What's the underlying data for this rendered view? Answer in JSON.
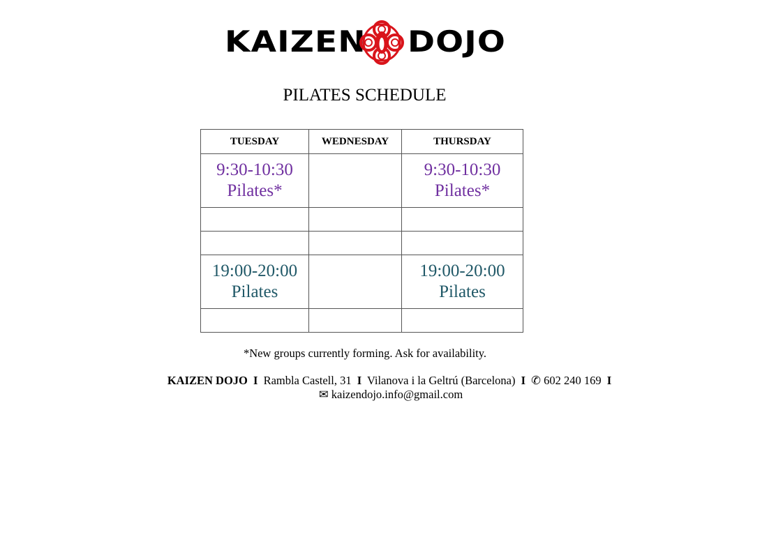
{
  "logo": {
    "left_text": "KAIZEN",
    "right_text": "DOJO",
    "emblem": "red-knot-crest-icon",
    "colors": {
      "text": "#000000",
      "emblem": "#d9141b"
    }
  },
  "title": "PILATES SCHEDULE",
  "schedule": {
    "headers": [
      "TUESDAY",
      "WEDNESDAY",
      "THURSDAY"
    ],
    "rows": [
      [
        {
          "time": "9:30-10:30",
          "name": "Pilates*"
        },
        {
          "time": "",
          "name": ""
        },
        {
          "time": "9:30-10:30",
          "name": "Pilates*"
        }
      ],
      [
        {
          "time": "",
          "name": ""
        },
        {
          "time": "",
          "name": ""
        },
        {
          "time": "",
          "name": ""
        }
      ],
      [
        {
          "time": "",
          "name": ""
        },
        {
          "time": "",
          "name": ""
        },
        {
          "time": "",
          "name": ""
        }
      ],
      [
        {
          "time": "19:00-20:00",
          "name": "Pilates"
        },
        {
          "time": "",
          "name": ""
        },
        {
          "time": "19:00-20:00",
          "name": "Pilates"
        }
      ],
      [
        {
          "time": "",
          "name": ""
        },
        {
          "time": "",
          "name": ""
        },
        {
          "time": "",
          "name": ""
        }
      ]
    ],
    "colors": {
      "morning": "#7030a0",
      "evening": "#215968"
    }
  },
  "footnote": "*New groups currently forming. Ask for availability.",
  "footer": {
    "brand": "KAIZEN DOJO",
    "separator": "I",
    "address": "Rambla Castell, 31",
    "city": "Vilanova i la Geltrú (Barcelona)",
    "phone_icon": "✆",
    "phone": "602 240 169",
    "email_icon": "✉",
    "email": "kaizendojo.info@gmail.com"
  }
}
